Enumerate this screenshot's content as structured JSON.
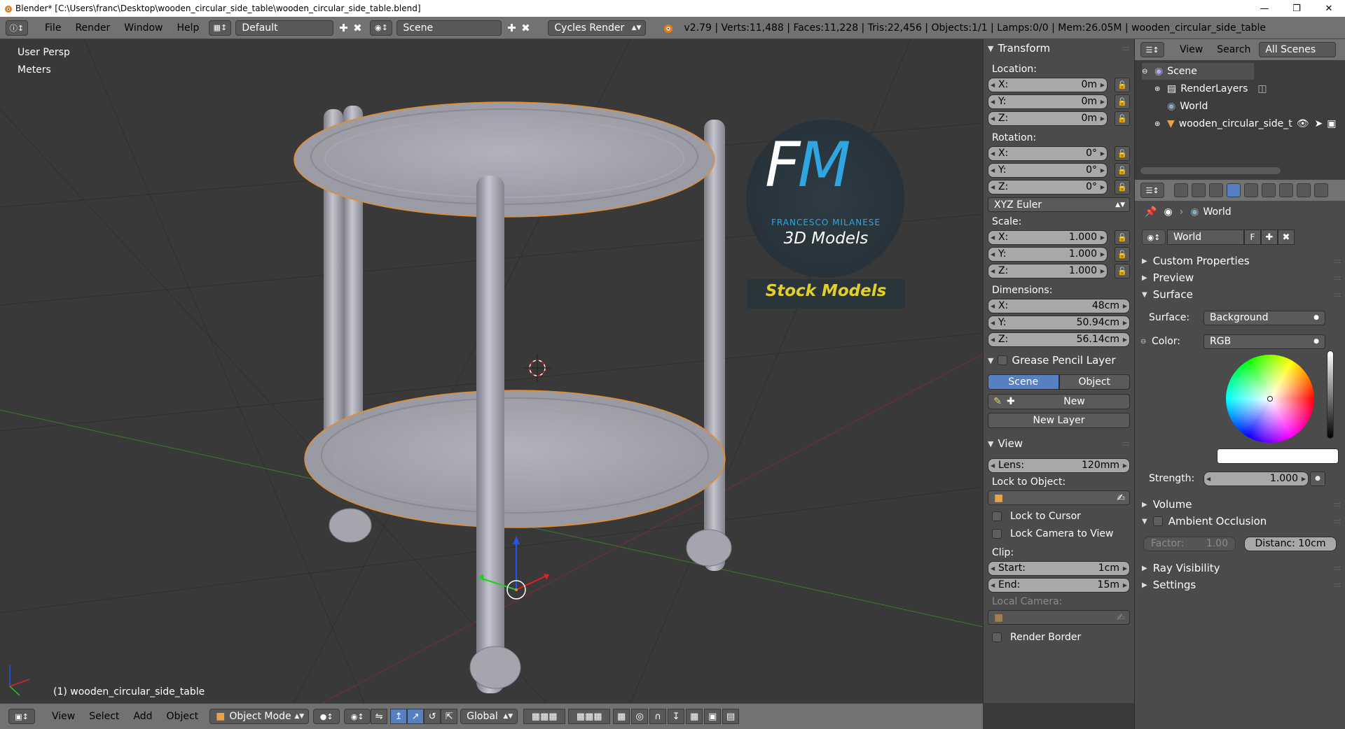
{
  "window": {
    "title": "Blender* [C:\\Users\\franc\\Desktop\\wooden_circular_side_table\\wooden_circular_side_table.blend]",
    "min": "—",
    "max": "❐",
    "close": "✕"
  },
  "infobar": {
    "menus": [
      "File",
      "Render",
      "Window",
      "Help"
    ],
    "layout": "Default",
    "scene": "Scene",
    "engine": "Cycles Render",
    "stats": "v2.79 | Verts:11,488 | Faces:11,228 | Tris:22,456 | Objects:1/1 | Lamps:0/0 | Mem:26.05M | wooden_circular_side_table"
  },
  "viewport": {
    "persp": "User Persp",
    "units": "Meters",
    "object_label": "(1) wooden_circular_side_table",
    "watermark": {
      "f": "F",
      "m": "M",
      "name": "FRANCESCO MILANESE",
      "line2": "3D Models",
      "stock": "Stock Models"
    }
  },
  "vp_header": {
    "menus": [
      "View",
      "Select",
      "Add",
      "Object"
    ],
    "mode": "Object Mode",
    "orientation": "Global"
  },
  "npanel": {
    "transform_title": "Transform",
    "location_label": "Location:",
    "location": [
      {
        "k": "X:",
        "v": "0m"
      },
      {
        "k": "Y:",
        "v": "0m"
      },
      {
        "k": "Z:",
        "v": "0m"
      }
    ],
    "rotation_label": "Rotation:",
    "rotation": [
      {
        "k": "X:",
        "v": "0°"
      },
      {
        "k": "Y:",
        "v": "0°"
      },
      {
        "k": "Z:",
        "v": "0°"
      }
    ],
    "rotation_mode": "XYZ Euler",
    "scale_label": "Scale:",
    "scale": [
      {
        "k": "X:",
        "v": "1.000"
      },
      {
        "k": "Y:",
        "v": "1.000"
      },
      {
        "k": "Z:",
        "v": "1.000"
      }
    ],
    "dimensions_label": "Dimensions:",
    "dimensions": [
      {
        "k": "X:",
        "v": "48cm"
      },
      {
        "k": "Y:",
        "v": "50.94cm"
      },
      {
        "k": "Z:",
        "v": "56.14cm"
      }
    ],
    "grease_title": "Grease Pencil Layer",
    "grease_tabs": [
      "Scene",
      "Object"
    ],
    "grease_new": "New",
    "grease_new_layer": "New Layer",
    "view_title": "View",
    "lens_k": "Lens:",
    "lens_v": "120mm",
    "lock_obj_label": "Lock to Object:",
    "lock_cursor": "Lock to Cursor",
    "lock_camera": "Lock Camera to View",
    "clip_label": "Clip:",
    "clip_start_k": "Start:",
    "clip_start_v": "1cm",
    "clip_end_k": "End:",
    "clip_end_v": "15m",
    "local_camera": "Local Camera:",
    "render_border": "Render Border"
  },
  "outliner": {
    "header": [
      "View",
      "Search",
      "All Scenes"
    ],
    "items": [
      "Scene",
      "RenderLayers",
      "World",
      "wooden_circular_side_t"
    ]
  },
  "props": {
    "context": "World",
    "world_name": "World",
    "world_f": "F",
    "sections": {
      "custom_props": "Custom Properties",
      "preview": "Preview",
      "surface": "Surface",
      "volume": "Volume",
      "ao": "Ambient Occlusion",
      "ray": "Ray Visibility",
      "settings": "Settings"
    },
    "surface_label": "Surface:",
    "surface_value": "Background",
    "color_label": "Color:",
    "color_value": "RGB",
    "strength_label": "Strength:",
    "strength_value": "1.000",
    "factor_k": "Factor:",
    "factor_v": "1.00",
    "distance": "Distanc: 10cm"
  },
  "colors": {
    "accent": "#5680c2",
    "header": "#727272",
    "viewport": "#393939",
    "panel": "#4b4b4b",
    "mesh": "#a9a9b4",
    "selection": "#e88c2a",
    "watermark_blue": "#2fa6e0",
    "watermark_yellow": "#e2d02a"
  }
}
